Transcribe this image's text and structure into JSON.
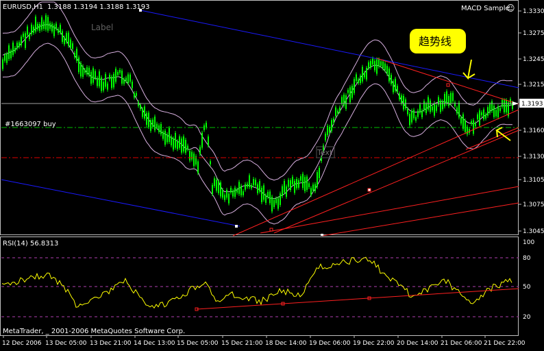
{
  "main_chart": {
    "symbol_header": "EURUSD,H1",
    "ohlc_header": "1.3188 1.3194 1.3188 1.3193",
    "indicator_name": "MACD Sample",
    "label_text": "Label",
    "text_object": "Text",
    "order_label": "#1663097 buy",
    "annotation": "趋势线",
    "price_ticks": [
      "1.3330",
      "1.3275",
      "1.3245",
      "1.3215",
      "1.3190",
      "1.3160",
      "1.3130",
      "1.3105",
      "1.3075",
      "1.3045"
    ],
    "current_price": "1.3193"
  },
  "rsi_panel": {
    "title": "RSI(14) 56.8313",
    "levels": [
      "100",
      "80",
      "50",
      "20",
      "0"
    ]
  },
  "footer": {
    "copyright": "MetaTrader, _ 2001-2006 MetaQuotes Software Corp."
  },
  "time_axis": {
    "labels": [
      "12 Dec 2006",
      "13 Dec 05:00",
      "13 Dec 21:00",
      "14 Dec 13:00",
      "15 Dec 05:00",
      "15 Dec 21:00",
      "18 Dec 14:00",
      "19 Dec 06:00",
      "19 Dec 22:00",
      "20 Dec 14:00",
      "21 Dec 06:00",
      "21 Dec 22:00"
    ]
  },
  "colors": {
    "candle": "#00ff00",
    "bands": "#d8b0e0",
    "channel": "#1a1aff",
    "trendline": "#ff2020",
    "order_line": "#00c000",
    "rsi_line": "#ffff00",
    "annotation": "#ffff00",
    "axis": "#c0c0c0"
  }
}
